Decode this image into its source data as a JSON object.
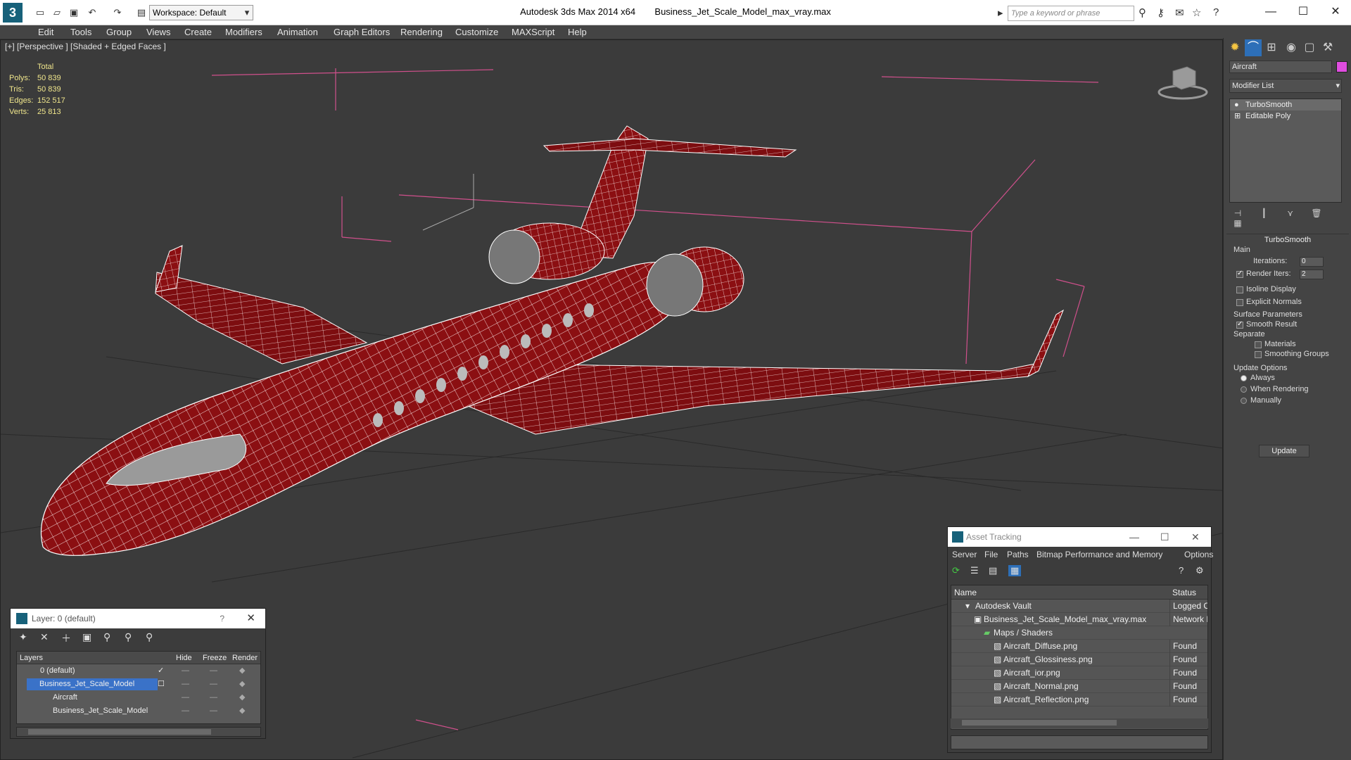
{
  "titlebar": {
    "workspace": "Workspace: Default",
    "app_title": "Autodesk 3ds Max  2014 x64",
    "file_title": "Business_Jet_Scale_Model_max_vray.max",
    "search_placeholder": "Type a keyword or phrase"
  },
  "menu": [
    "Edit",
    "Tools",
    "Group",
    "Views",
    "Create",
    "Modifiers",
    "Animation",
    "Graph Editors",
    "Rendering",
    "Customize",
    "MAXScript",
    "Help"
  ],
  "viewport": {
    "label": "[+] [Perspective ] [Shaded + Edged Faces ]",
    "stats": {
      "total_label": "Total",
      "polys_label": "Polys:",
      "polys": "50 839",
      "tris_label": "Tris:",
      "tris": "50 839",
      "edges_label": "Edges:",
      "edges": "152 517",
      "verts_label": "Verts:",
      "verts": "25 813"
    },
    "model_color": "#8b0f12",
    "wire_color": "#ffffff"
  },
  "command_panel": {
    "object_name": "Aircraft",
    "object_color": "#e04de0",
    "modifier_list": "Modifier List",
    "stack": [
      "TurboSmooth",
      "Editable Poly"
    ],
    "turbosmooth": {
      "title": "TurboSmooth",
      "main_label": "Main",
      "iterations_label": "Iterations:",
      "iterations": "0",
      "render_iters_label": "Render Iters:",
      "render_iters": "2",
      "isoline": "Isoline Display",
      "explicit": "Explicit Normals",
      "surface_label": "Surface Parameters",
      "smooth_result": "Smooth Result",
      "separate_label": "Separate",
      "materials": "Materials",
      "smoothing_groups": "Smoothing Groups",
      "update_options_label": "Update Options",
      "always": "Always",
      "when_rendering": "When Rendering",
      "manually": "Manually",
      "update_button": "Update"
    }
  },
  "layer_dialog": {
    "title": "Layer: 0 (default)",
    "help": "?",
    "columns": {
      "layers": "Layers",
      "hide": "Hide",
      "freeze": "Freeze",
      "render": "Render"
    },
    "rows": [
      "0 (default)",
      "Business_Jet_Scale_Model",
      "Aircraft",
      "Business_Jet_Scale_Model"
    ]
  },
  "asset_dialog": {
    "title": "Asset Tracking",
    "menu": [
      "Server",
      "File",
      "Paths",
      "Bitmap Performance and Memory",
      "Options"
    ],
    "columns": {
      "name": "Name",
      "status": "Status"
    },
    "rows": [
      {
        "name": "Autodesk Vault",
        "status": "Logged Out"
      },
      {
        "name": "Business_Jet_Scale_Model_max_vray.max",
        "status": "Network Path"
      },
      {
        "name": "Maps / Shaders",
        "status": ""
      },
      {
        "name": "Aircraft_Diffuse.png",
        "status": "Found"
      },
      {
        "name": "Aircraft_Glossiness.png",
        "status": "Found"
      },
      {
        "name": "Aircraft_ior.png",
        "status": "Found"
      },
      {
        "name": "Aircraft_Normal.png",
        "status": "Found"
      },
      {
        "name": "Aircraft_Reflection.png",
        "status": "Found"
      }
    ]
  }
}
